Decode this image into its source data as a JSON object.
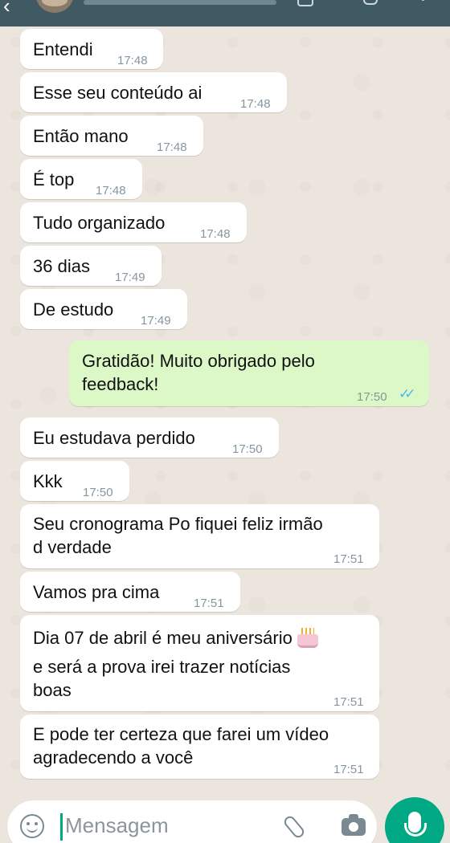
{
  "header": {
    "back_glyph": "‹"
  },
  "messages": [
    {
      "direction": "in",
      "text": "Entendi",
      "time": "17:48"
    },
    {
      "direction": "in",
      "text": "Esse seu conteúdo ai",
      "time": "17:48"
    },
    {
      "direction": "in",
      "text": "Então mano",
      "time": "17:48"
    },
    {
      "direction": "in",
      "text": "É top",
      "time": "17:48"
    },
    {
      "direction": "in",
      "text": "Tudo organizado",
      "time": "17:48"
    },
    {
      "direction": "in",
      "text": "36 dias",
      "time": "17:49"
    },
    {
      "direction": "in",
      "text": "De estudo",
      "time": "17:49"
    },
    {
      "direction": "out",
      "lines": [
        "Gratidão! Muito obrigado pelo",
        "feedback!"
      ],
      "time": "17:50",
      "status": "read"
    },
    {
      "direction": "in",
      "text": "Eu estudava perdido",
      "time": "17:50"
    },
    {
      "direction": "in",
      "text": "Kkk",
      "time": "17:50"
    },
    {
      "direction": "in",
      "lines": [
        "Seu cronograma Po fiquei feliz irmão",
        "d verdade"
      ],
      "time": "17:51"
    },
    {
      "direction": "in",
      "text": "Vamos pra cima",
      "time": "17:51"
    },
    {
      "direction": "in",
      "lines": [
        "Dia 07 de abril é meu aniversário",
        "e será a prova irei trazer notícias",
        "boas"
      ],
      "emoji": "birthday-cake",
      "time": "17:51"
    },
    {
      "direction": "in",
      "lines": [
        "E pode ter certeza que farei um vídeo",
        "agradecendo a você"
      ],
      "time": "17:51"
    }
  ],
  "composer": {
    "placeholder": "Mensagem"
  },
  "colors": {
    "header": "#3F5A63",
    "background": "#ECE5DD",
    "incoming_bubble": "#FFFFFF",
    "outgoing_bubble": "#DCF8C6",
    "read_ticks": "#4FB6EC",
    "accent": "#00A884"
  },
  "icons": [
    "back-arrow-icon",
    "avatar",
    "call-icon",
    "video-call-icon",
    "menu-icon",
    "emoji-icon",
    "attach-clip-icon",
    "camera-icon",
    "microphone-icon",
    "read-ticks-icon",
    "birthday-cake-icon"
  ]
}
